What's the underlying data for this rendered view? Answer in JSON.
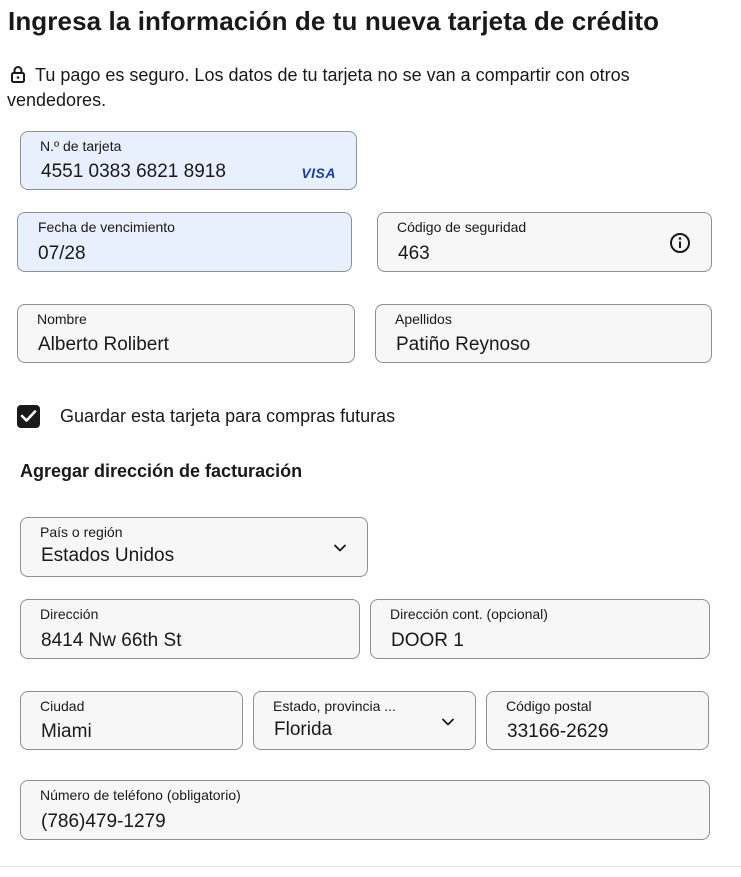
{
  "page": {
    "title": "Ingresa la información de tu nueva tarjeta de crédito",
    "secure_note": "Tu pago es seguro. Los datos de tu tarjeta no se van a compartir con otros vendedores."
  },
  "card": {
    "number_label": "N.º de tarjeta",
    "number_value": "4551 0383 6821 8918",
    "brand": "VISA",
    "expiry_label": "Fecha de vencimiento",
    "expiry_value": "07/28",
    "cvv_label": "Código de seguridad",
    "cvv_value": "463",
    "first_name_label": "Nombre",
    "first_name_value": "Alberto Rolibert",
    "last_name_label": "Apellidos",
    "last_name_value": "Patiño Reynoso",
    "save_label": "Guardar esta tarjeta para compras futuras",
    "save_checked": true
  },
  "billing": {
    "section_title": "Agregar dirección de facturación",
    "country_label": "País o región",
    "country_value": "Estados Unidos",
    "address_label": "Dirección",
    "address_value": "8414 Nw 66th St",
    "address2_label": "Dirección cont. (opcional)",
    "address2_value": "DOOR 1",
    "city_label": "Ciudad",
    "city_value": "Miami",
    "state_label": "Estado, provincia ...",
    "state_value": "Florida",
    "zip_label": "Código postal",
    "zip_value": "33166-2629",
    "phone_label": "Número de teléfono (obligatorio)",
    "phone_value": "(786)479-1279"
  },
  "colors": {
    "autofill_bg": "#e8f0fe",
    "field_bg": "#f7f7f7",
    "visa_blue": "#1a3fa8"
  }
}
